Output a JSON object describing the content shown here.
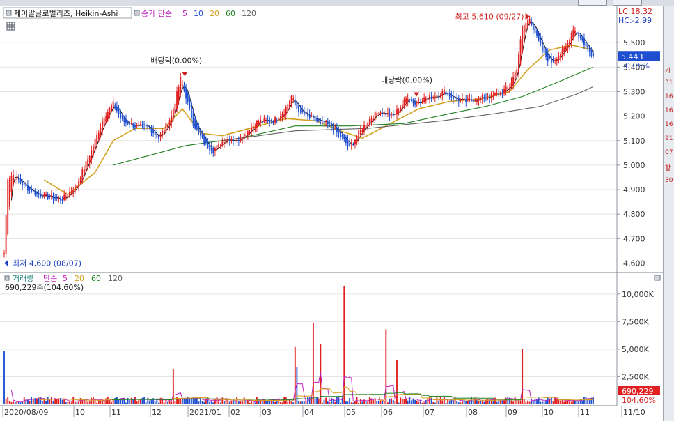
{
  "window": {
    "title": "제이알글로벌리츠, Heikin-Ashi"
  },
  "price_legend": {
    "ma_label": "종가 단순",
    "periods": [
      "5",
      "10",
      "20",
      "60",
      "120"
    ],
    "period_colors": [
      "#c020c0",
      "#1f4fd0",
      "#d4a020",
      "#208020",
      "#606060"
    ]
  },
  "volume_legend": {
    "title": "거래량",
    "ma_label": "단순",
    "periods": [
      "5",
      "20",
      "60",
      "120"
    ],
    "period_colors": [
      "#c020c0",
      "#d4a020",
      "#208020",
      "#606060"
    ],
    "current": "690,229주(104.60%)"
  },
  "indicators": {
    "lc": "LC:18.32",
    "hc": "HC:-2.99",
    "last_price": "5,443",
    "last_change": "-0.05%",
    "last_volume": "690,229",
    "last_volume_pct": "104.60%"
  },
  "annotations": {
    "high": "최고 5,610 (09/27)",
    "low": "최저 4,600 (08/07)",
    "dividend_1": "배당락(0.00%)",
    "dividend_2": "배당락(0.00%)"
  },
  "right_strip": {
    "fragments": [
      "가",
      "31",
      "16",
      "16",
      "16",
      "91",
      "07",
      "할",
      "30"
    ]
  },
  "colors": {
    "up": "#e02020",
    "down": "#2050d0",
    "ma5": "#c020c0",
    "ma10": "#111111",
    "ma20": "#d4a020",
    "ma60": "#208020",
    "ma120": "#606060",
    "grid": "#e4e4e4",
    "price_badge": "#1f4fd0",
    "volume_badge": "#e02020"
  },
  "chart_data": [
    {
      "type": "candlestick",
      "name": "price",
      "series_style": "Heikin-Ashi",
      "x_labels": [
        "2020/08/09",
        "10",
        "11",
        "12",
        "2021/01",
        "02",
        "03",
        "04",
        "05",
        "06",
        "07",
        "08",
        "09",
        "10",
        "11",
        "11/10"
      ],
      "y_ticks": [
        4600,
        4700,
        4800,
        4900,
        5000,
        5100,
        5200,
        5300,
        5400,
        5500
      ],
      "y_tick_labels": [
        "4,600",
        "4,700",
        "4,800",
        "4,900",
        "5,000",
        "5,100",
        "5,200",
        "5,300",
        "5,400",
        "5,500"
      ],
      "ylim": [
        4570,
        5640
      ],
      "grid": true,
      "close_path": [
        [
          0,
          4640
        ],
        [
          2,
          4950
        ],
        [
          5,
          4960
        ],
        [
          10,
          4920
        ],
        [
          18,
          4880
        ],
        [
          25,
          4870
        ],
        [
          32,
          4860
        ],
        [
          40,
          4920
        ],
        [
          48,
          5060
        ],
        [
          55,
          5200
        ],
        [
          60,
          5250
        ],
        [
          65,
          5180
        ],
        [
          72,
          5160
        ],
        [
          80,
          5150
        ],
        [
          85,
          5110
        ],
        [
          92,
          5200
        ],
        [
          97,
          5350
        ],
        [
          100,
          5280
        ],
        [
          104,
          5170
        ],
        [
          110,
          5090
        ],
        [
          115,
          5060
        ],
        [
          122,
          5110
        ],
        [
          128,
          5100
        ],
        [
          134,
          5140
        ],
        [
          140,
          5180
        ],
        [
          148,
          5180
        ],
        [
          154,
          5220
        ],
        [
          158,
          5280
        ],
        [
          161,
          5230
        ],
        [
          166,
          5200
        ],
        [
          172,
          5180
        ],
        [
          180,
          5160
        ],
        [
          186,
          5110
        ],
        [
          190,
          5070
        ],
        [
          195,
          5130
        ],
        [
          200,
          5180
        ],
        [
          206,
          5220
        ],
        [
          210,
          5210
        ],
        [
          214,
          5200
        ],
        [
          218,
          5240
        ],
        [
          222,
          5280
        ],
        [
          226,
          5250
        ],
        [
          230,
          5270
        ],
        [
          236,
          5280
        ],
        [
          242,
          5300
        ],
        [
          248,
          5270
        ],
        [
          254,
          5260
        ],
        [
          260,
          5270
        ],
        [
          266,
          5280
        ],
        [
          272,
          5290
        ],
        [
          278,
          5320
        ],
        [
          282,
          5400
        ],
        [
          285,
          5560
        ],
        [
          289,
          5600
        ],
        [
          293,
          5520
        ],
        [
          297,
          5450
        ],
        [
          301,
          5420
        ],
        [
          305,
          5450
        ],
        [
          309,
          5480
        ],
        [
          313,
          5560
        ],
        [
          317,
          5520
        ],
        [
          321,
          5470
        ],
        [
          324,
          5443
        ]
      ],
      "ma_series": [
        {
          "period": 20,
          "points": [
            [
              22,
              4940
            ],
            [
              35,
              4880
            ],
            [
              50,
              4970
            ],
            [
              60,
              5100
            ],
            [
              72,
              5150
            ],
            [
              88,
              5150
            ],
            [
              98,
              5230
            ],
            [
              108,
              5130
            ],
            [
              120,
              5120
            ],
            [
              140,
              5160
            ],
            [
              155,
              5190
            ],
            [
              172,
              5180
            ],
            [
              185,
              5140
            ],
            [
              197,
              5110
            ],
            [
              210,
              5160
            ],
            [
              228,
              5230
            ],
            [
              245,
              5260
            ],
            [
              262,
              5270
            ],
            [
              278,
              5300
            ],
            [
              288,
              5390
            ],
            [
              300,
              5470
            ],
            [
              312,
              5490
            ],
            [
              324,
              5470
            ]
          ]
        },
        {
          "period": 60,
          "points": [
            [
              60,
              5000
            ],
            [
              80,
              5040
            ],
            [
              100,
              5080
            ],
            [
              130,
              5110
            ],
            [
              160,
              5160
            ],
            [
              190,
              5160
            ],
            [
              220,
              5170
            ],
            [
              245,
              5210
            ],
            [
              265,
              5240
            ],
            [
              285,
              5280
            ],
            [
              305,
              5340
            ],
            [
              324,
              5400
            ]
          ]
        },
        {
          "period": 120,
          "points": [
            [
              120,
              5100
            ],
            [
              160,
              5140
            ],
            [
              200,
              5150
            ],
            [
              240,
              5180
            ],
            [
              270,
              5210
            ],
            [
              295,
              5240
            ],
            [
              315,
              5290
            ],
            [
              324,
              5320
            ]
          ]
        }
      ],
      "high": {
        "value": 5610,
        "date": "09/27"
      },
      "low": {
        "value": 4600,
        "date": "08/07"
      },
      "last": 5443
    },
    {
      "type": "bar",
      "name": "volume",
      "unit": "shares",
      "y_ticks": [
        2500000,
        5000000,
        7500000,
        10000000
      ],
      "y_tick_labels": [
        "2,500K",
        "5,000K",
        "7,500K",
        "10,000K"
      ],
      "ylim": [
        0,
        11000000
      ],
      "spikes": [
        {
          "x": 0,
          "value": 4800000,
          "dir": "down"
        },
        {
          "x": 93,
          "value": 3200000,
          "dir": "up"
        },
        {
          "x": 160,
          "value": 5200000,
          "dir": "up"
        },
        {
          "x": 161,
          "value": 3400000,
          "dir": "down"
        },
        {
          "x": 170,
          "value": 7400000,
          "dir": "up"
        },
        {
          "x": 174,
          "value": 5500000,
          "dir": "up"
        },
        {
          "x": 187,
          "value": 10700000,
          "dir": "up"
        },
        {
          "x": 210,
          "value": 6800000,
          "dir": "up"
        },
        {
          "x": 216,
          "value": 4000000,
          "dir": "up"
        },
        {
          "x": 285,
          "value": 5000000,
          "dir": "up"
        }
      ],
      "baseline_volume": 350000,
      "last": 690229,
      "last_pct": "104.60%"
    }
  ]
}
